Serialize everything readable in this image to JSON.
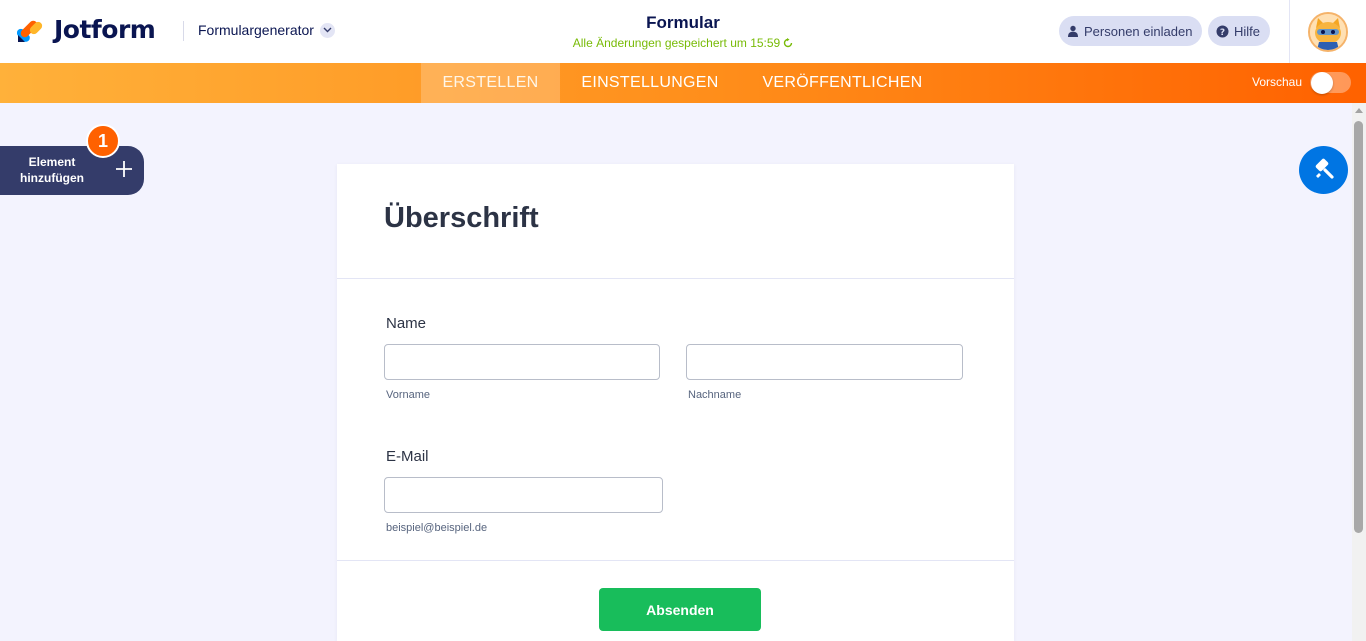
{
  "header": {
    "logo_text": "Jotform",
    "builder_label": "Formulargenerator",
    "form_title": "Formular",
    "saved_status": "Alle Änderungen gespeichert um 15:59",
    "invite_label": "Personen einladen",
    "help_label": "Hilfe"
  },
  "nav": {
    "tabs": [
      {
        "label": "ERSTELLEN",
        "active": true
      },
      {
        "label": "EINSTELLUNGEN",
        "active": false
      },
      {
        "label": "VERÖFFENTLICHEN",
        "active": false
      }
    ],
    "preview_label": "Vorschau",
    "preview_on": false
  },
  "sidebar": {
    "add_element_label": "Element hinzufügen",
    "badge_count": "1"
  },
  "form": {
    "heading": "Überschrift",
    "name_label": "Name",
    "first_name_value": "",
    "first_name_sublabel": "Vorname",
    "last_name_value": "",
    "last_name_sublabel": "Nachname",
    "email_label": "E-Mail",
    "email_value": "",
    "email_sublabel": "beispiel@beispiel.de",
    "submit_label": "Absenden"
  },
  "colors": {
    "brand_navy": "#0a1551",
    "nav_orange_start": "#ffb13a",
    "nav_orange_end": "#ff6100",
    "saved_green": "#78bb07",
    "submit_green": "#18bd5b",
    "designer_blue": "#0075e3",
    "badge_orange": "#ff6100"
  },
  "icons": [
    "jotform-logo-icon",
    "chevron-down-icon",
    "refresh-icon",
    "user-icon",
    "help-circle-icon",
    "avatar-cat-icon",
    "plus-icon",
    "paint-roller-icon"
  ]
}
